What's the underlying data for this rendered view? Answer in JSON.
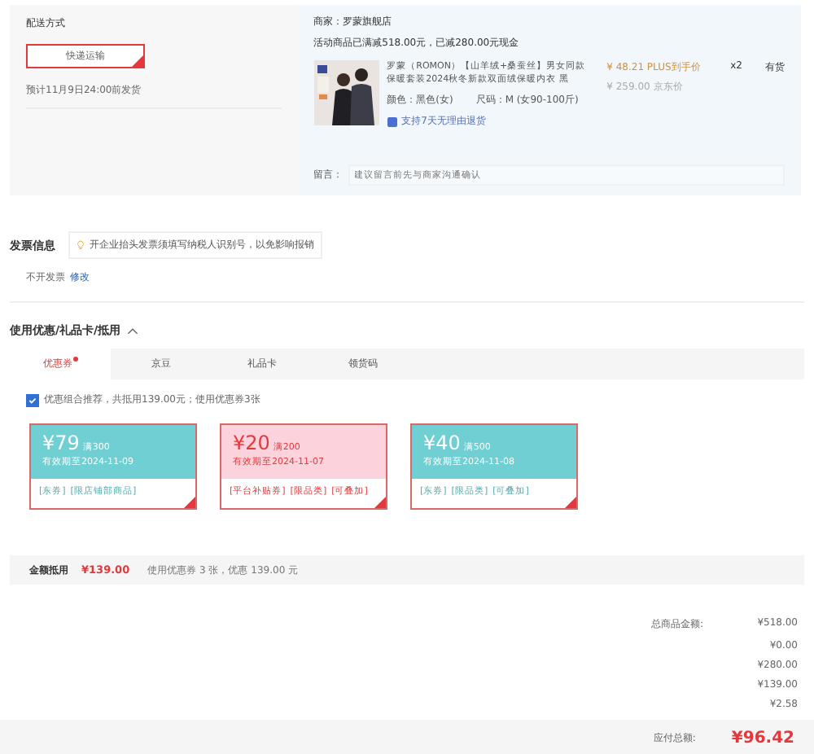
{
  "delivery": {
    "title": "配送方式",
    "options": [
      {
        "label": "快递运输",
        "selected": true
      }
    ],
    "eta": "预计11月9日24:00前发货"
  },
  "shop": {
    "merchant": "商家：罗蒙旗舰店",
    "promo": "活动商品已满减518.00元，已减280.00元现金",
    "product": {
      "title": "罗蒙（ROMON）【山羊绒+桑蚕丝】男女同款保暖套装2024秋冬新款双面绒保暖内衣 黑",
      "price": "¥ 48.21 PLUS到手价",
      "list_price": "¥ 259.00 京东价",
      "qty": "x2",
      "stock": "有货",
      "color_option": "颜色：黑色(女)",
      "size": "尺码：M (女90-100斤)",
      "return_policy": "支持7天无理由退货"
    },
    "note": {
      "label": "留言：",
      "placeholder": "建议留言前先与商家沟通确认"
    }
  },
  "invoice": {
    "title": "发票信息",
    "hint": "开企业抬头发票须填写纳税人识别号，以免影响报销",
    "value": "不开发票",
    "edit": "修改"
  },
  "discounts": {
    "title": "使用优惠/礼品卡/抵用",
    "expanded": true,
    "tabs": [
      {
        "label": "优惠券",
        "selected": true,
        "marked": true
      },
      {
        "label": "京豆",
        "selected": false,
        "marked": false
      },
      {
        "label": "礼品卡",
        "selected": false,
        "marked": false
      },
      {
        "label": "领货码",
        "selected": false,
        "marked": false
      }
    ],
    "recommend": {
      "checked": true,
      "label": "优惠组合推荐，共抵用139.00元；使用优惠券3张"
    },
    "coupons": [
      {
        "amount": "¥79",
        "condition": "满300",
        "valid": "有效期至2024-11-09",
        "tags": [
          "[东券]",
          "[限店铺部商品]"
        ],
        "color": "#6fcfd3",
        "selected": true
      },
      {
        "amount": "¥20",
        "condition": "满200",
        "valid": "有效期至2024-11-07",
        "tags": [
          "[平台补贴券]",
          "[限品类]",
          "[可叠加]"
        ],
        "color": "#fcd3dc",
        "selected": true
      },
      {
        "amount": "¥40",
        "condition": "满500",
        "valid": "有效期至2024-11-08",
        "tags": [
          "[东券]",
          "[限品类]",
          "[可叠加]"
        ],
        "color": "#6fcfd3",
        "selected": true
      }
    ],
    "summary": {
      "label": "金额抵用",
      "amount": "¥139.00",
      "detail": "使用优惠券 3 张，优惠 139.00 元"
    }
  },
  "totals": {
    "rows": [
      {
        "label": "总商品金额:",
        "value": "¥518.00"
      },
      {
        "value": "¥0.00"
      },
      {
        "value": "¥280.00"
      },
      {
        "value": "¥139.00"
      },
      {
        "value": "¥2.58"
      }
    ],
    "payable_label": "应付总额:",
    "payable": "¥96.42"
  }
}
